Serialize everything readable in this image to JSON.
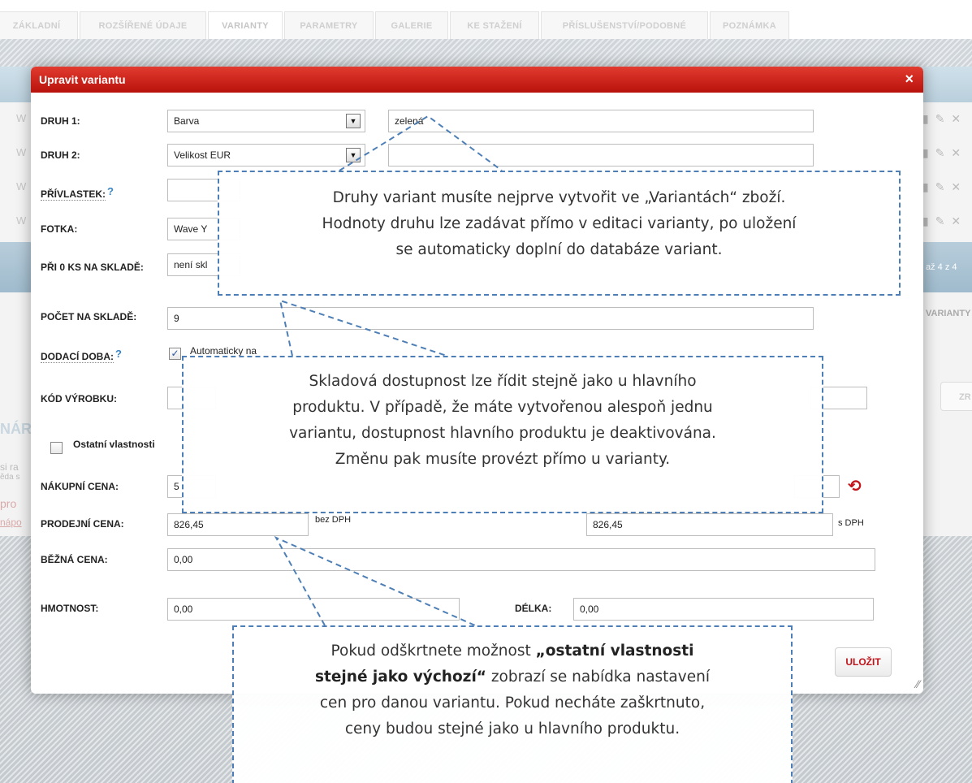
{
  "background": {
    "tabs": [
      {
        "label": "ZÁKLADNÍ ÚDAJE"
      },
      {
        "label": "ROZŠÍŘENÉ ÚDAJE"
      },
      {
        "label": "VARIANTY"
      },
      {
        "label": "PARAMETRY"
      },
      {
        "label": "GALERIE"
      },
      {
        "label": "KE STAŽENÍ"
      },
      {
        "label": "PŘÍSLUŠENSTVÍ/PODOBNÉ"
      },
      {
        "label": "POZNÁMKA"
      }
    ],
    "row_letter": "W",
    "pagination_text": "až 4 z 4",
    "variants_label": "VARIANTY",
    "left_fragments": [
      "NÁR",
      "si ra",
      "ěda s",
      "pro",
      "nápo"
    ],
    "zr_button": "ZR"
  },
  "modal": {
    "title": "Upravit variantu",
    "close": "×",
    "fields": {
      "druh1": {
        "label": "DRUH 1:",
        "select": "Barva",
        "value": "zelená"
      },
      "druh2": {
        "label": "DRUH 2:",
        "select": "Velikost EUR",
        "value": ""
      },
      "privlastek": {
        "label": "PŘÍVLASTEK:",
        "help": "?",
        "value": ""
      },
      "fotka": {
        "label": "FOTKA:",
        "value": "Wave Y"
      },
      "pri0ks": {
        "label": "PŘI 0 KS NA SKLADĚ:",
        "value": "není skl"
      },
      "pocet": {
        "label": "POČET NA SKLADĚ:",
        "value": "9"
      },
      "dodaci": {
        "label": "DODACÍ DOBA:",
        "help": "?",
        "checkbox_text": "Automaticky na"
      },
      "kod": {
        "label": "KÓD VÝROBKU:",
        "value": ""
      },
      "ostatni": {
        "label": "Ostatní vlastnosti"
      },
      "nakupni": {
        "label": "NÁKUPNÍ CENA:",
        "value": "5"
      },
      "prodejni": {
        "label": "PRODEJNÍ CENA:",
        "value_net": "826,45",
        "unit_net": "bez DPH",
        "value_gross": "826,45",
        "unit_gross": "s DPH"
      },
      "bezna": {
        "label": "BĚŽNÁ CENA:",
        "value": "0,00"
      },
      "hmotnost": {
        "label": "HMOTNOST:",
        "value": "0,00"
      },
      "delka": {
        "label": "DÉLKA:",
        "value": "0,00"
      }
    },
    "save_label": "ULOŽIT"
  },
  "callouts": {
    "c1": {
      "line1": "Druhy variant musíte nejprve vytvořit ve „Variantách“ zboží.",
      "line2": "Hodnoty druhu lze zadávat přímo v editaci varianty, po uložení",
      "line3": "se automaticky doplní do databáze variant."
    },
    "c2": {
      "line1": "Skladová dostupnost lze řídit stejně jako u hlavního",
      "line2": "produktu. V případě, že máte vytvořenou alespoň jednu",
      "line3": "variantu, dostupnost hlavního produktu je deaktivována.",
      "line4": "Změnu pak musíte provézt přímo u varianty."
    },
    "c3": {
      "pre": "Pokud odškrtnete možnost ",
      "bold1": "„ostatní vlastnosti",
      "bold2": "stejné jako výchozí“",
      "post1": " zobrazí se nabídka nastavení",
      "line3": "cen pro danou variantu. Pokud necháte zaškrtnuto,",
      "line4": "ceny budou stejné jako u hlavního produktu."
    }
  },
  "colors": {
    "titlebar": "#c8201a",
    "accent_blue": "#4d7fb6",
    "save_text": "#c0141c"
  },
  "icons": {
    "close": "close-icon",
    "help": "question-mark-icon",
    "dropdown": "chevron-down-icon",
    "refresh": "refresh-icon",
    "resize": "resize-grip-icon",
    "row_actions": [
      "document-icon",
      "pencil-icon",
      "delete-icon"
    ]
  }
}
